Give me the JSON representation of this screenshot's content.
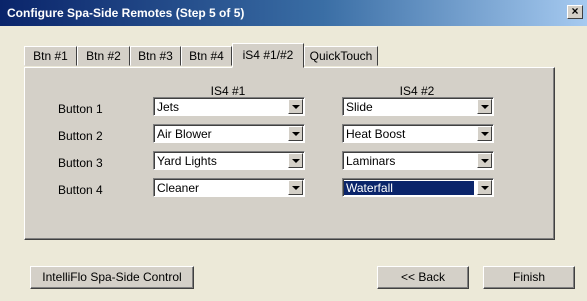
{
  "window": {
    "title": "Configure Spa-Side Remotes (Step 5 of 5)",
    "close_label": "×"
  },
  "tabs": [
    {
      "label": "Btn #1"
    },
    {
      "label": "Btn #2"
    },
    {
      "label": "Btn #3"
    },
    {
      "label": "Btn #4"
    },
    {
      "label": "iS4 #1/#2",
      "active": true
    },
    {
      "label": "QuickTouch"
    }
  ],
  "columns": {
    "col1": "IS4 #1",
    "col2": "IS4 #2"
  },
  "rows": [
    {
      "label": "Button 1",
      "is4_1": "Jets",
      "is4_2": "Slide"
    },
    {
      "label": "Button 2",
      "is4_1": "Air Blower",
      "is4_2": "Heat Boost"
    },
    {
      "label": "Button 3",
      "is4_1": "Yard Lights",
      "is4_2": "Laminars"
    },
    {
      "label": "Button 4",
      "is4_1": "Cleaner",
      "is4_2": "Waterfall"
    }
  ],
  "selected_combo": "rows.3.is4_2",
  "buttons": {
    "intelliflo": "IntelliFlo Spa-Side Control",
    "back": "<< Back",
    "finish": "Finish"
  },
  "colors": {
    "title_bar": "#0a246a",
    "face": "#d4d0c8",
    "selection": "#0a246a"
  }
}
